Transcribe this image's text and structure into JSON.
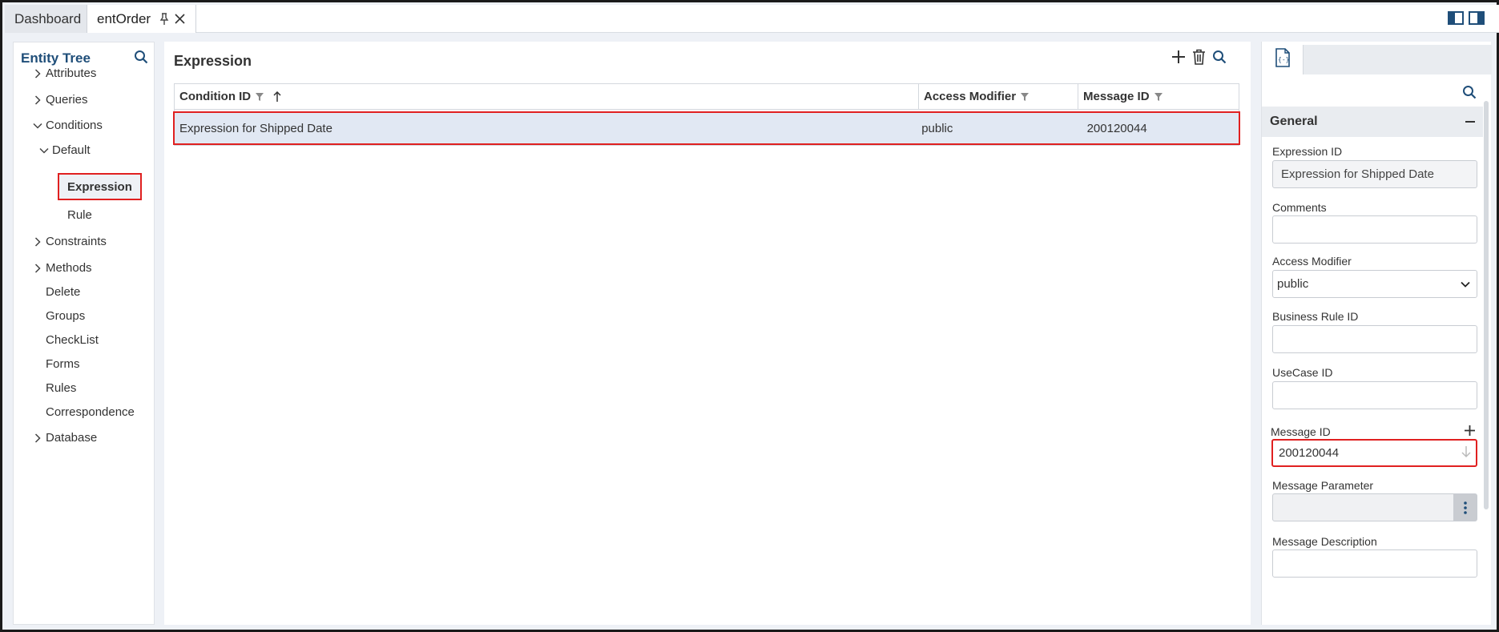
{
  "tabs": [
    {
      "label": "Dashboard"
    },
    {
      "label": "entOrder"
    }
  ],
  "left_panel": {
    "title": "Entity Tree",
    "items": [
      {
        "label": "Attributes"
      },
      {
        "label": "Queries"
      },
      {
        "label": "Conditions"
      },
      {
        "label": "Default"
      },
      {
        "label": "Expression"
      },
      {
        "label": "Rule"
      },
      {
        "label": "Constraints"
      },
      {
        "label": "Methods"
      },
      {
        "label": "Delete"
      },
      {
        "label": "Groups"
      },
      {
        "label": "CheckList"
      },
      {
        "label": "Forms"
      },
      {
        "label": "Rules"
      },
      {
        "label": "Correspondence"
      },
      {
        "label": "Database"
      }
    ]
  },
  "center": {
    "title": "Expression",
    "columns": [
      "Condition ID",
      "Access Modifier",
      "Message ID"
    ],
    "rows": [
      {
        "condition_id": "Expression for Shipped Date",
        "access_modifier": "public",
        "message_id": "200120044"
      }
    ]
  },
  "right_panel": {
    "section": "General",
    "expression_id_label": "Expression ID",
    "expression_id_value": "Expression for Shipped Date",
    "comments_label": "Comments",
    "comments_value": "",
    "access_modifier_label": "Access Modifier",
    "access_modifier_value": "public",
    "business_rule_label": "Business Rule ID",
    "business_rule_value": "",
    "usecase_label": "UseCase ID",
    "usecase_value": "",
    "message_id_label": "Message ID",
    "message_id_value": "200120044",
    "message_param_label": "Message Parameter",
    "message_desc_label": "Message Description",
    "message_desc_value": ""
  },
  "colors": {
    "accent": "#1f4e79",
    "highlight": "#e02020",
    "selected_row": "#e1e8f3"
  },
  "icons": [
    "pin-icon",
    "close-icon",
    "layout-left-icon",
    "layout-right-icon",
    "search-icon",
    "plus-icon",
    "trash-icon",
    "filter-icon",
    "sort-asc-icon",
    "chevron-right-icon",
    "chevron-down-icon",
    "code-file-icon",
    "collapse-icon",
    "kebab-icon"
  ]
}
